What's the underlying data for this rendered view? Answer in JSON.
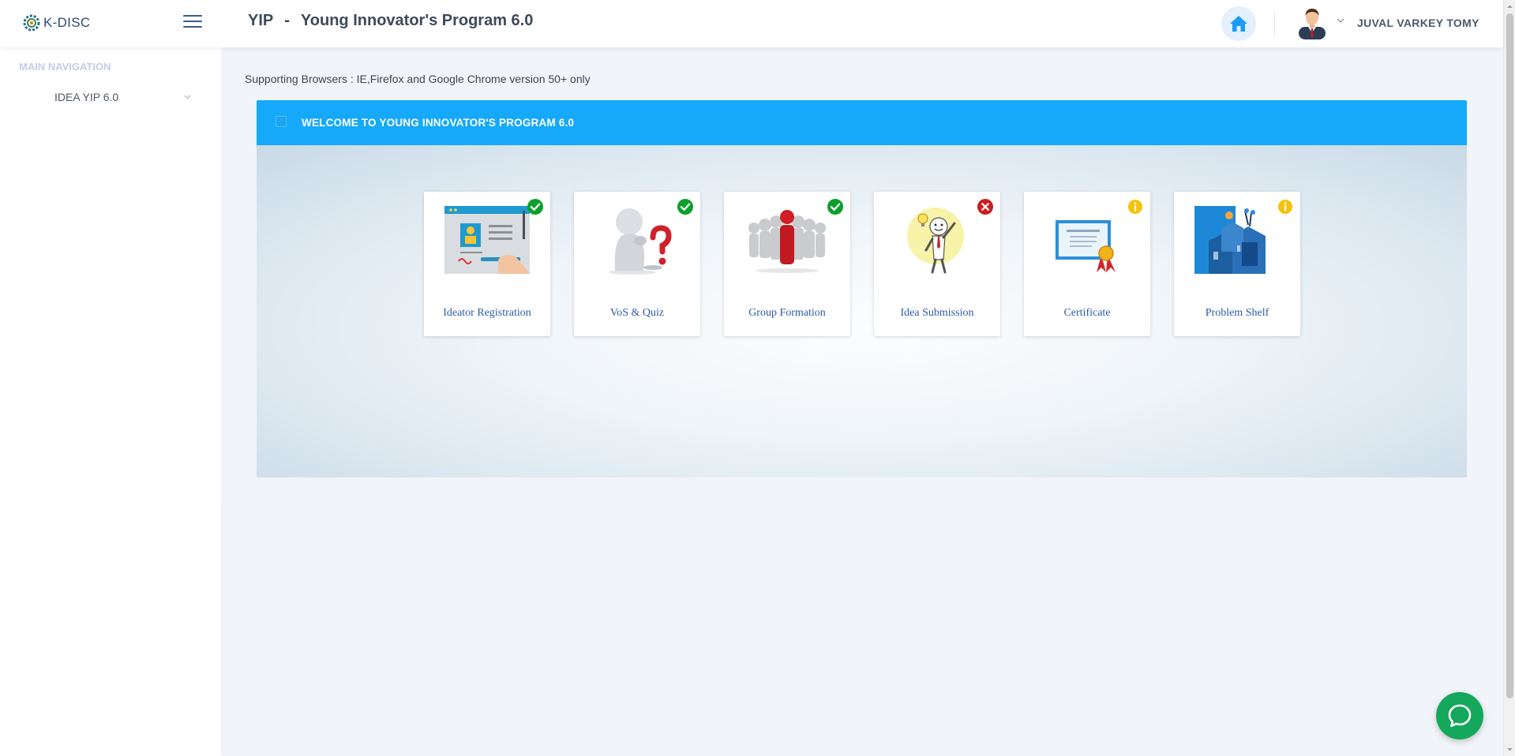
{
  "header": {
    "logo_text": "K-DISC",
    "app_short": "YIP",
    "separator": "-",
    "app_title": "Young Innovator's Program 6.0",
    "home_icon": "home-icon",
    "user_name": "JUVAL VARKEY TOMY",
    "colors": {
      "home_accent": "#1a9cf5",
      "home_bg": "#e4f0fb"
    }
  },
  "sidebar": {
    "heading": "MAIN NAVIGATION",
    "items": [
      {
        "label": "IDEA YIP 6.0",
        "icon": "chevron-down-icon"
      }
    ]
  },
  "main": {
    "browser_note": "Supporting Browsers : IE,Firefox and Google Chrome version 50+ only",
    "panel_title": "WELCOME TO YOUNG INNOVATOR'S PROGRAM 6.0",
    "panel_color": "#16a9f9",
    "cards": [
      {
        "label": "Ideator Registration",
        "status": "completed",
        "status_icon": "check-circle-icon",
        "image": "registration-form-illustration"
      },
      {
        "label": "VoS & Quiz",
        "status": "completed",
        "status_icon": "check-circle-icon",
        "image": "thinking-figure-question-illustration"
      },
      {
        "label": "Group Formation",
        "status": "completed",
        "status_icon": "check-circle-icon",
        "image": "group-leader-figures-illustration"
      },
      {
        "label": "Idea Submission",
        "status": "rejected",
        "status_icon": "x-circle-icon",
        "image": "idea-bulb-figure-illustration"
      },
      {
        "label": "Certificate",
        "status": "info",
        "status_icon": "info-circle-icon",
        "image": "certificate-ribbon-illustration"
      },
      {
        "label": "Problem Shelf",
        "status": "info",
        "status_icon": "info-circle-icon",
        "image": "problem-shelf-illustration"
      }
    ],
    "status_colors": {
      "completed": "#0c9f2c",
      "rejected": "#cc1e1e",
      "info": "#f4c20d"
    }
  },
  "chat": {
    "icon": "chat-bubble-icon",
    "color": "#13a85c"
  }
}
